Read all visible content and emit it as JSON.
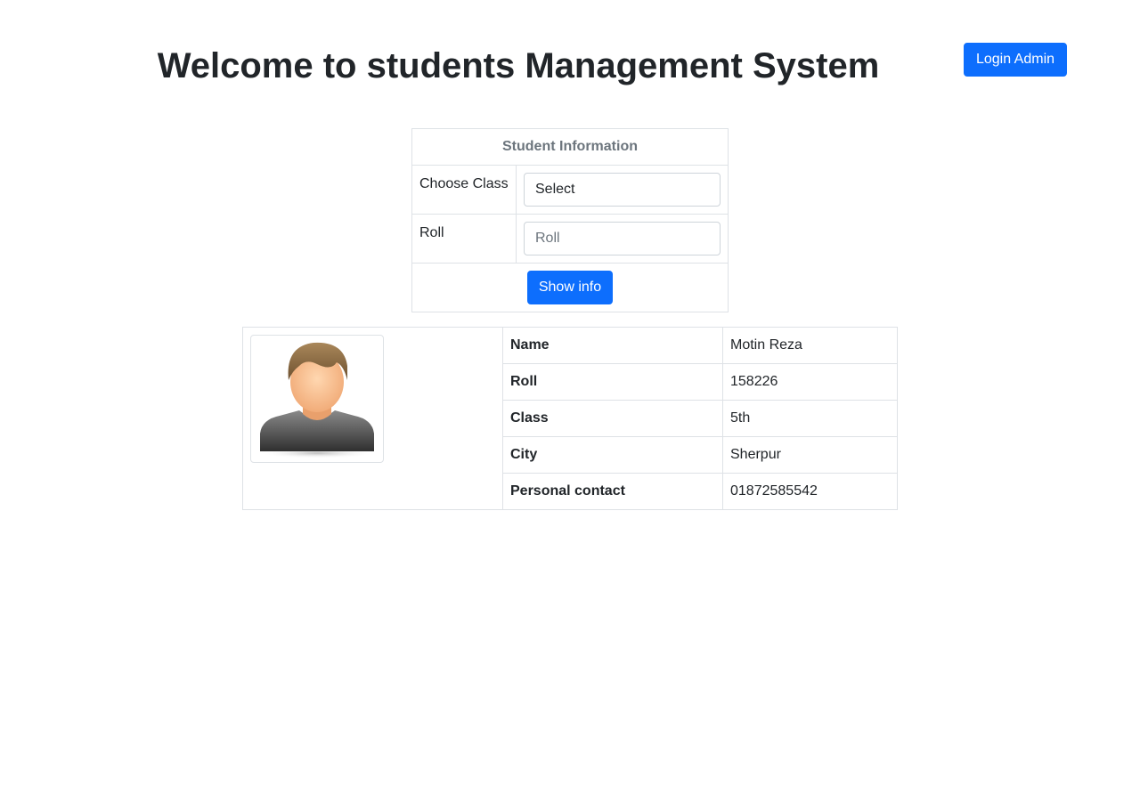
{
  "header": {
    "title": "Welcome to students Management System",
    "login_label": "Login Admin"
  },
  "search": {
    "heading": "Student Information",
    "class_label": "Choose Class",
    "class_selected": "Select",
    "roll_label": "Roll",
    "roll_placeholder": "Roll",
    "submit_label": "Show info"
  },
  "student": {
    "rows": [
      {
        "key": "Name",
        "value": "Motin Reza"
      },
      {
        "key": "Roll",
        "value": "158226"
      },
      {
        "key": "Class",
        "value": "5th"
      },
      {
        "key": "City",
        "value": "Sherpur"
      },
      {
        "key": "Personal contact",
        "value": "01872585542"
      }
    ],
    "avatar_icon": "user-avatar-icon"
  },
  "colors": {
    "primary": "#0d6efd",
    "border": "#dee2e6",
    "muted": "#6c757d"
  }
}
